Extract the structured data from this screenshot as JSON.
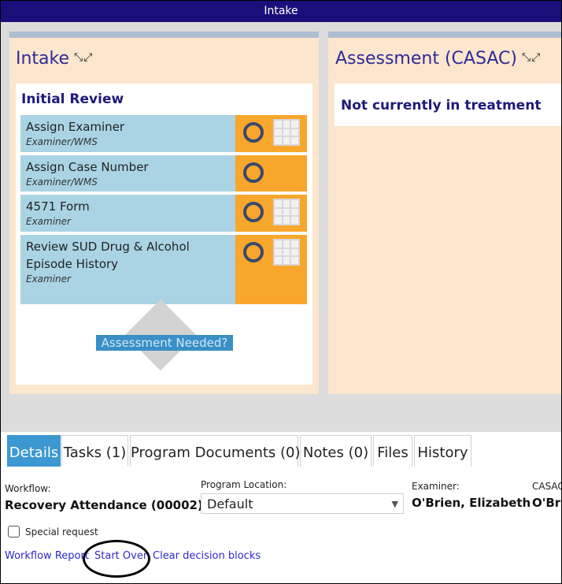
{
  "window": {
    "title": "Intake"
  },
  "lanes": [
    {
      "title": "Intake",
      "icons": "expand-collapse",
      "card": {
        "title": "Initial Review",
        "tasks": [
          {
            "name": "Assign Examiner",
            "role": "Examiner/WMS",
            "has_grid": true
          },
          {
            "name": "Assign Case Number",
            "role": "Examiner/WMS",
            "has_grid": false
          },
          {
            "name": "4571 Form",
            "role": "Examiner",
            "has_grid": true
          },
          {
            "name": "Review SUD Drug & Alcohol Episode History",
            "role": "Examiner",
            "has_grid": true
          }
        ]
      },
      "decision": "Assessment Needed?"
    },
    {
      "title": "Assessment (CASAC)",
      "icons": "expand-collapse",
      "card": {
        "title": "Not currently in treatment"
      }
    }
  ],
  "tabs": [
    "Details",
    "Tasks (1)",
    "Program Documents (0)",
    "Notes (0)",
    "Files",
    "History"
  ],
  "details": {
    "workflow_label": "Workflow:",
    "workflow_value": "Recovery Attendance (00002)",
    "program_location_label": "Program Location:",
    "program_location_value": "Default",
    "examiner_label": "Examiner:",
    "examiner_value": "O'Brien, Elizabeth",
    "casac_label": "CASAC",
    "casac_value": "O'Bri",
    "special_request_label": "Special request"
  },
  "links": {
    "workflow_report": "Workflow Report",
    "start_over": "Start Over",
    "clear_decision_blocks": "Clear decision blocks"
  },
  "colors": {
    "titlebar": "#1a0f7a",
    "lane_bg": "#fce6cd",
    "task_bg": "#aad4e3",
    "task_action": "#f9a72c",
    "tab_active": "#3b98d0",
    "link": "#2a2ad0"
  }
}
